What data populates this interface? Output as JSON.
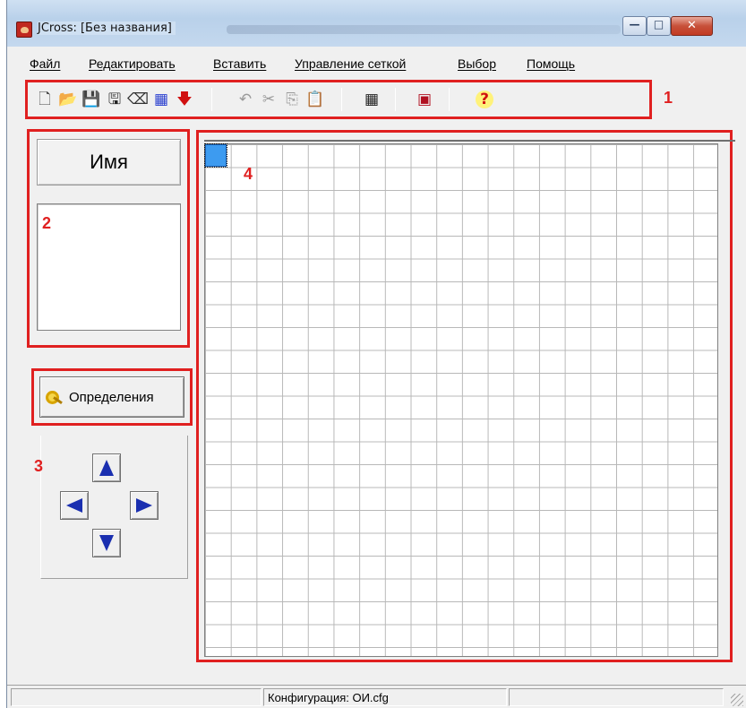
{
  "window": {
    "title": "JCross: [Без названия]",
    "min_glyph": "—",
    "max_glyph": "□",
    "close_glyph": "✕"
  },
  "menu": {
    "items": [
      {
        "label": "Файл"
      },
      {
        "label": "Редактировать"
      },
      {
        "label": "Вставить"
      },
      {
        "label": "Управление сеткой"
      },
      {
        "label": "Выбор"
      },
      {
        "label": "Помощь"
      }
    ]
  },
  "toolbar": {
    "icons": [
      {
        "name": "new-file-icon",
        "glyph": "🗋"
      },
      {
        "name": "open-folder-icon",
        "glyph": "📂"
      },
      {
        "name": "save-icon",
        "glyph": "💾"
      },
      {
        "name": "save-as-icon",
        "glyph": "🖫"
      },
      {
        "name": "eraser-icon",
        "glyph": "⌫"
      },
      {
        "name": "grid-pattern-icon",
        "glyph": "▦"
      },
      {
        "name": "down-arrow-icon",
        "glyph": "🡇"
      },
      {
        "name": "undo-icon",
        "glyph": "↶"
      },
      {
        "name": "cut-icon",
        "glyph": "✂"
      },
      {
        "name": "copy-icon",
        "glyph": "⎘"
      },
      {
        "name": "paste-icon",
        "glyph": "📋"
      },
      {
        "name": "grid-table-icon",
        "glyph": "▦"
      },
      {
        "name": "palette-icon",
        "glyph": "▣"
      },
      {
        "name": "help-icon",
        "glyph": "?"
      }
    ]
  },
  "labels": {
    "one": "1",
    "two": "2",
    "three": "3",
    "four": "4"
  },
  "left_panel": {
    "header": "Имя",
    "definitions_button": "Определения"
  },
  "statusbar": {
    "config": "Конфигурация: ОИ.cfg"
  },
  "colors": {
    "highlight_border": "#e02020",
    "selected_cell": "#3d9bf0",
    "arrow_blue": "#1a2fb0",
    "arrow_red": "#d01010"
  }
}
